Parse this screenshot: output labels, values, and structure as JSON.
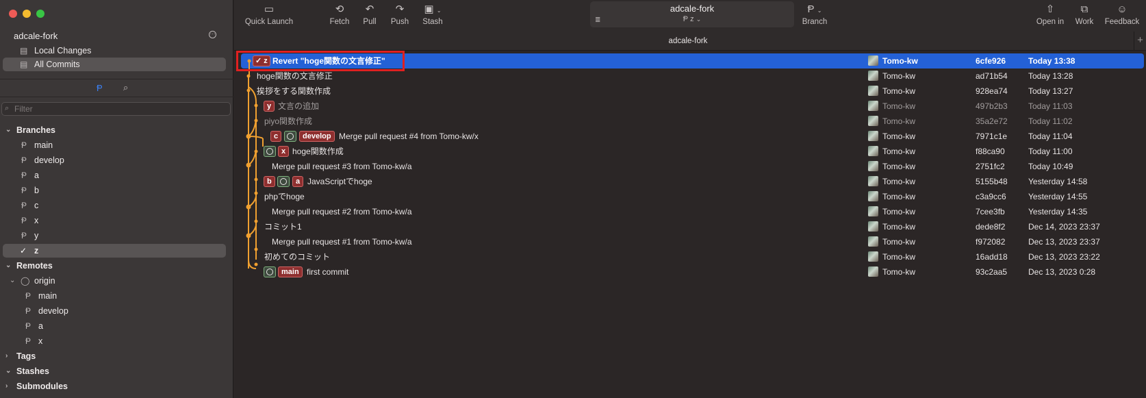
{
  "sidebar": {
    "repo_name": "adcale-fork",
    "local_changes": "Local Changes",
    "all_commits": "All Commits",
    "filter_placeholder": "Filter",
    "branches_header": "Branches",
    "branches": [
      "main",
      "develop",
      "a",
      "b",
      "c",
      "x",
      "y",
      "z"
    ],
    "current_branch": "z",
    "remotes_header": "Remotes",
    "remote_name": "origin",
    "remote_branches": [
      "main",
      "develop",
      "a",
      "x"
    ],
    "tags_header": "Tags",
    "stashes_header": "Stashes",
    "submodules_header": "Submodules"
  },
  "toolbar": {
    "quick_launch": "Quick Launch",
    "fetch": "Fetch",
    "pull": "Pull",
    "push": "Push",
    "stash": "Stash",
    "repo_title": "adcale-fork",
    "current_branch": "z",
    "branch": "Branch",
    "open_in": "Open in",
    "work": "Work",
    "feedback": "Feedback"
  },
  "tab": {
    "title": "adcale-fork"
  },
  "commits": [
    {
      "message": "Revert \"hoge関数の文言修正\"",
      "badges": [
        "✓ z"
      ],
      "author": "Tomo-kw",
      "sha": "6cfe926",
      "date": "Today 13:38",
      "selected": true
    },
    {
      "message": "hoge関数の文言修正",
      "badges": [],
      "author": "Tomo-kw",
      "sha": "ad71b54",
      "date": "Today 13:28"
    },
    {
      "message": "挨拶をする関数作成",
      "badges": [],
      "author": "Tomo-kw",
      "sha": "928ea74",
      "date": "Today 13:27"
    },
    {
      "message": "文言の追加",
      "badges": [
        "y"
      ],
      "author": "Tomo-kw",
      "sha": "497b2b3",
      "date": "Today 11:03",
      "dim": true
    },
    {
      "message": "piyo関数作成",
      "badges": [],
      "author": "Tomo-kw",
      "sha": "35a2e72",
      "date": "Today 11:02",
      "dim": true
    },
    {
      "message": "Merge pull request #4 from Tomo-kw/x",
      "badges": [
        "c",
        "gh",
        "develop"
      ],
      "author": "Tomo-kw",
      "sha": "7971c1e",
      "date": "Today 11:04"
    },
    {
      "message": "hoge関数作成",
      "badges": [
        "gh",
        "x"
      ],
      "author": "Tomo-kw",
      "sha": "f88ca90",
      "date": "Today 11:00"
    },
    {
      "message": "Merge pull request #3 from Tomo-kw/a",
      "badges": [],
      "author": "Tomo-kw",
      "sha": "2751fc2",
      "date": "Today 10:49"
    },
    {
      "message": "JavaScriptでhoge",
      "badges": [
        "b",
        "gh",
        "a"
      ],
      "author": "Tomo-kw",
      "sha": "5155b48",
      "date": "Yesterday 14:58"
    },
    {
      "message": "phpでhoge",
      "badges": [],
      "author": "Tomo-kw",
      "sha": "c3a9cc6",
      "date": "Yesterday 14:55"
    },
    {
      "message": "Merge pull request #2 from Tomo-kw/a",
      "badges": [],
      "author": "Tomo-kw",
      "sha": "7cee3fb",
      "date": "Yesterday 14:35"
    },
    {
      "message": "コミット1",
      "badges": [],
      "author": "Tomo-kw",
      "sha": "dede8f2",
      "date": "Dec 14, 2023 23:37"
    },
    {
      "message": "Merge pull request #1 from Tomo-kw/a",
      "badges": [],
      "author": "Tomo-kw",
      "sha": "f972082",
      "date": "Dec 13, 2023 23:37"
    },
    {
      "message": "初めてのコミット",
      "badges": [],
      "author": "Tomo-kw",
      "sha": "16add18",
      "date": "Dec 13, 2023 23:22"
    },
    {
      "message": "first commit",
      "badges": [
        "gh",
        "main"
      ],
      "author": "Tomo-kw",
      "sha": "93c2aa5",
      "date": "Dec 13, 2023 0:28"
    }
  ],
  "colors": {
    "graph_orange": "#f0a030",
    "selection_blue": "#2461d6",
    "badge_red": "#8e2f2f",
    "highlight_red": "#e02020"
  }
}
